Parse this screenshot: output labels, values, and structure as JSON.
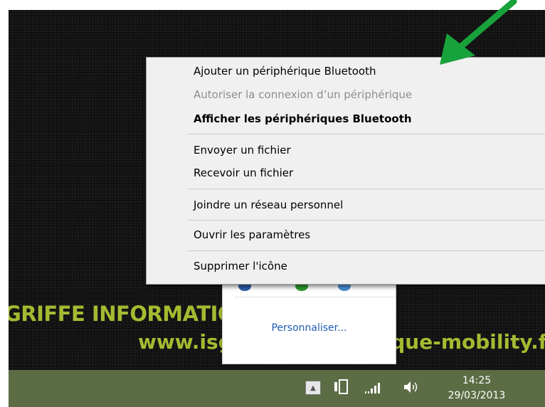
{
  "wallpaper": {
    "title": "GRIFFE INFORMATIQUE MOBILE",
    "url": "www.isgriffe-informatique-mobility.fr"
  },
  "context_menu": {
    "items": [
      {
        "label": "Ajouter un périphérique Bluetooth",
        "state": "enabled"
      },
      {
        "label": "Autoriser la connexion d’un périphérique",
        "state": "disabled"
      },
      {
        "label": "Afficher les périphériques Bluetooth",
        "state": "default"
      },
      {
        "label": "Envoyer un fichier",
        "state": "enabled"
      },
      {
        "label": "Recevoir un fichier",
        "state": "enabled"
      },
      {
        "label": "Joindre un réseau personnel",
        "state": "enabled"
      },
      {
        "label": "Ouvrir les paramètres",
        "state": "enabled"
      },
      {
        "label": "Supprimer l'icône",
        "state": "enabled"
      }
    ]
  },
  "tray_overflow": {
    "customize_link": "Personnaliser..."
  },
  "taskbar": {
    "show_hidden_icon": "chevron-up-icon",
    "tray_icons": [
      "action-center-icon",
      "network-signal-icon",
      "speaker-icon"
    ],
    "clock_time": "14:25",
    "clock_date": "29/03/2013"
  },
  "annotation": {
    "arrow_color": "#18a23c"
  },
  "colors": {
    "wallpaper_text": "#a6ba31",
    "taskbar": "#5c6c44",
    "menu_background": "#f0f0f0",
    "link": "#1f5cb1"
  }
}
